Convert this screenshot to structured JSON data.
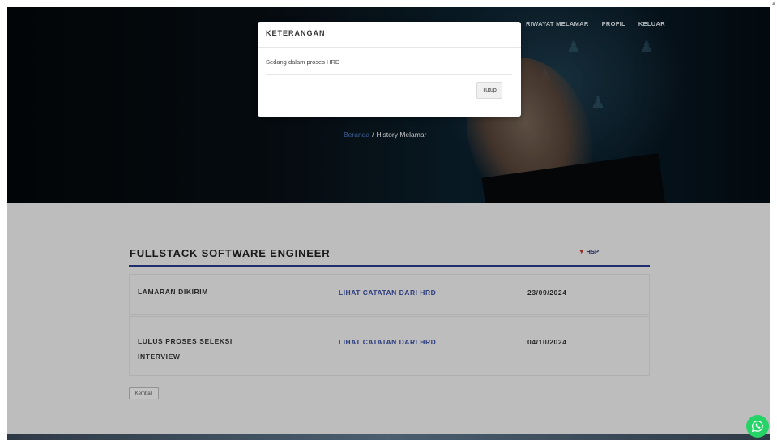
{
  "nav": {
    "items": [
      {
        "label": "RIWAYAT MELAMAR"
      },
      {
        "label": "PROFIL"
      },
      {
        "label": "KELUAR"
      }
    ]
  },
  "breadcrumb": {
    "home": "Beranda",
    "separator": "/",
    "current": "History Melamar"
  },
  "job": {
    "title": "FULLSTACK SOFTWARE ENGINEER",
    "company_logo_text": "HSP",
    "history": [
      {
        "status": "LAMARAN DIKIRIM",
        "link": "LIHAT CATATAN DARI HRD",
        "date": "23/09/2024"
      },
      {
        "status": "LULUS PROSES SELEKSI INTERVIEW",
        "link": "LIHAT CATATAN DARI HRD",
        "date": "04/10/2024"
      }
    ],
    "back_label": "Kembali"
  },
  "modal": {
    "title": "KETERANGAN",
    "body": "Sedang dalam proses HRD",
    "close_label": "Tutup"
  },
  "colors": {
    "accent": "#2b3a8c",
    "link": "#3a4fa3",
    "whatsapp": "#25d366"
  },
  "icons": {
    "whatsapp": "whatsapp-icon"
  }
}
